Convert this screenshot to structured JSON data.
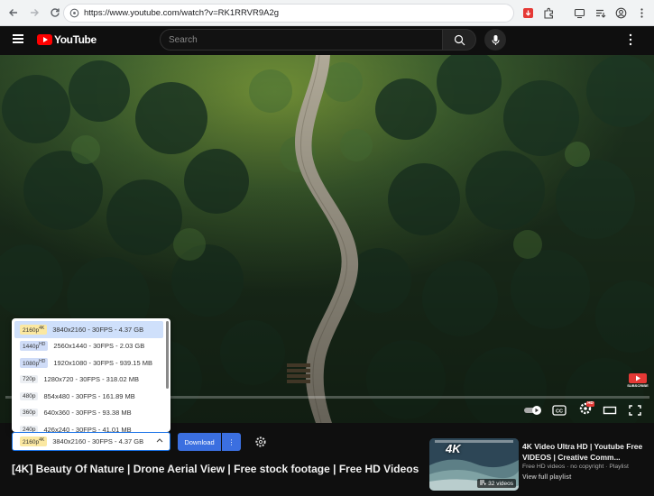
{
  "browser": {
    "url": "https://www.youtube.com/watch?v=RK1RRVR9A2g",
    "icons": [
      "back-arrow-icon",
      "forward-arrow-icon",
      "reload-icon",
      "site-info-icon",
      "extension-download-icon",
      "puzzle-extensions-icon",
      "screen-cast-icon",
      "reading-list-icon",
      "profile-icon",
      "kebab-menu-icon"
    ]
  },
  "youtube": {
    "logo_text": "YouTube",
    "search_placeholder": "Search"
  },
  "quality_options": [
    {
      "res": "2160p",
      "tag": "4K",
      "text": "3840x2160 - 30FPS - 4.37 GB",
      "kind": "4k"
    },
    {
      "res": "1440p",
      "tag": "HD",
      "text": "2560x1440 - 30FPS - 2.03 GB",
      "kind": "hd"
    },
    {
      "res": "1080p",
      "tag": "HD",
      "text": "1920x1080 - 30FPS - 939.15 MB",
      "kind": "hd"
    },
    {
      "res": "720p",
      "tag": "",
      "text": "1280x720 - 30FPS - 318.02 MB",
      "kind": "sd"
    },
    {
      "res": "480p",
      "tag": "",
      "text": "854x480 - 30FPS - 161.89 MB",
      "kind": "sd"
    },
    {
      "res": "360p",
      "tag": "",
      "text": "640x360 - 30FPS - 93.38 MB",
      "kind": "sd"
    },
    {
      "res": "240p",
      "tag": "",
      "text": "426x240 - 30FPS - 41.01 MB",
      "kind": "sd"
    }
  ],
  "selected": {
    "res": "2160p",
    "tag": "4K",
    "text": "3840x2160 - 30FPS - 4.37 GB"
  },
  "toolbar": {
    "download_label": "Download",
    "more_label": "⋮"
  },
  "video_title": "[4K] Beauty Of Nature | Drone Aerial View | Free stock footage | Free HD Videos",
  "playlist": {
    "thumb_label": "4K",
    "count": "32 videos",
    "title": "4K Video Ultra HD | Youtube Free VIDEOS | Creative Comm...",
    "meta": "Free HD videos · no copyright · Playlist",
    "link": "View full playlist"
  },
  "player": {
    "icons": [
      "autoplay-toggle-icon",
      "captions-icon",
      "settings-icon",
      "theater-mode-icon",
      "fullscreen-icon"
    ],
    "settings_badge": "HD"
  },
  "watermark": "SUBSCRIBE"
}
